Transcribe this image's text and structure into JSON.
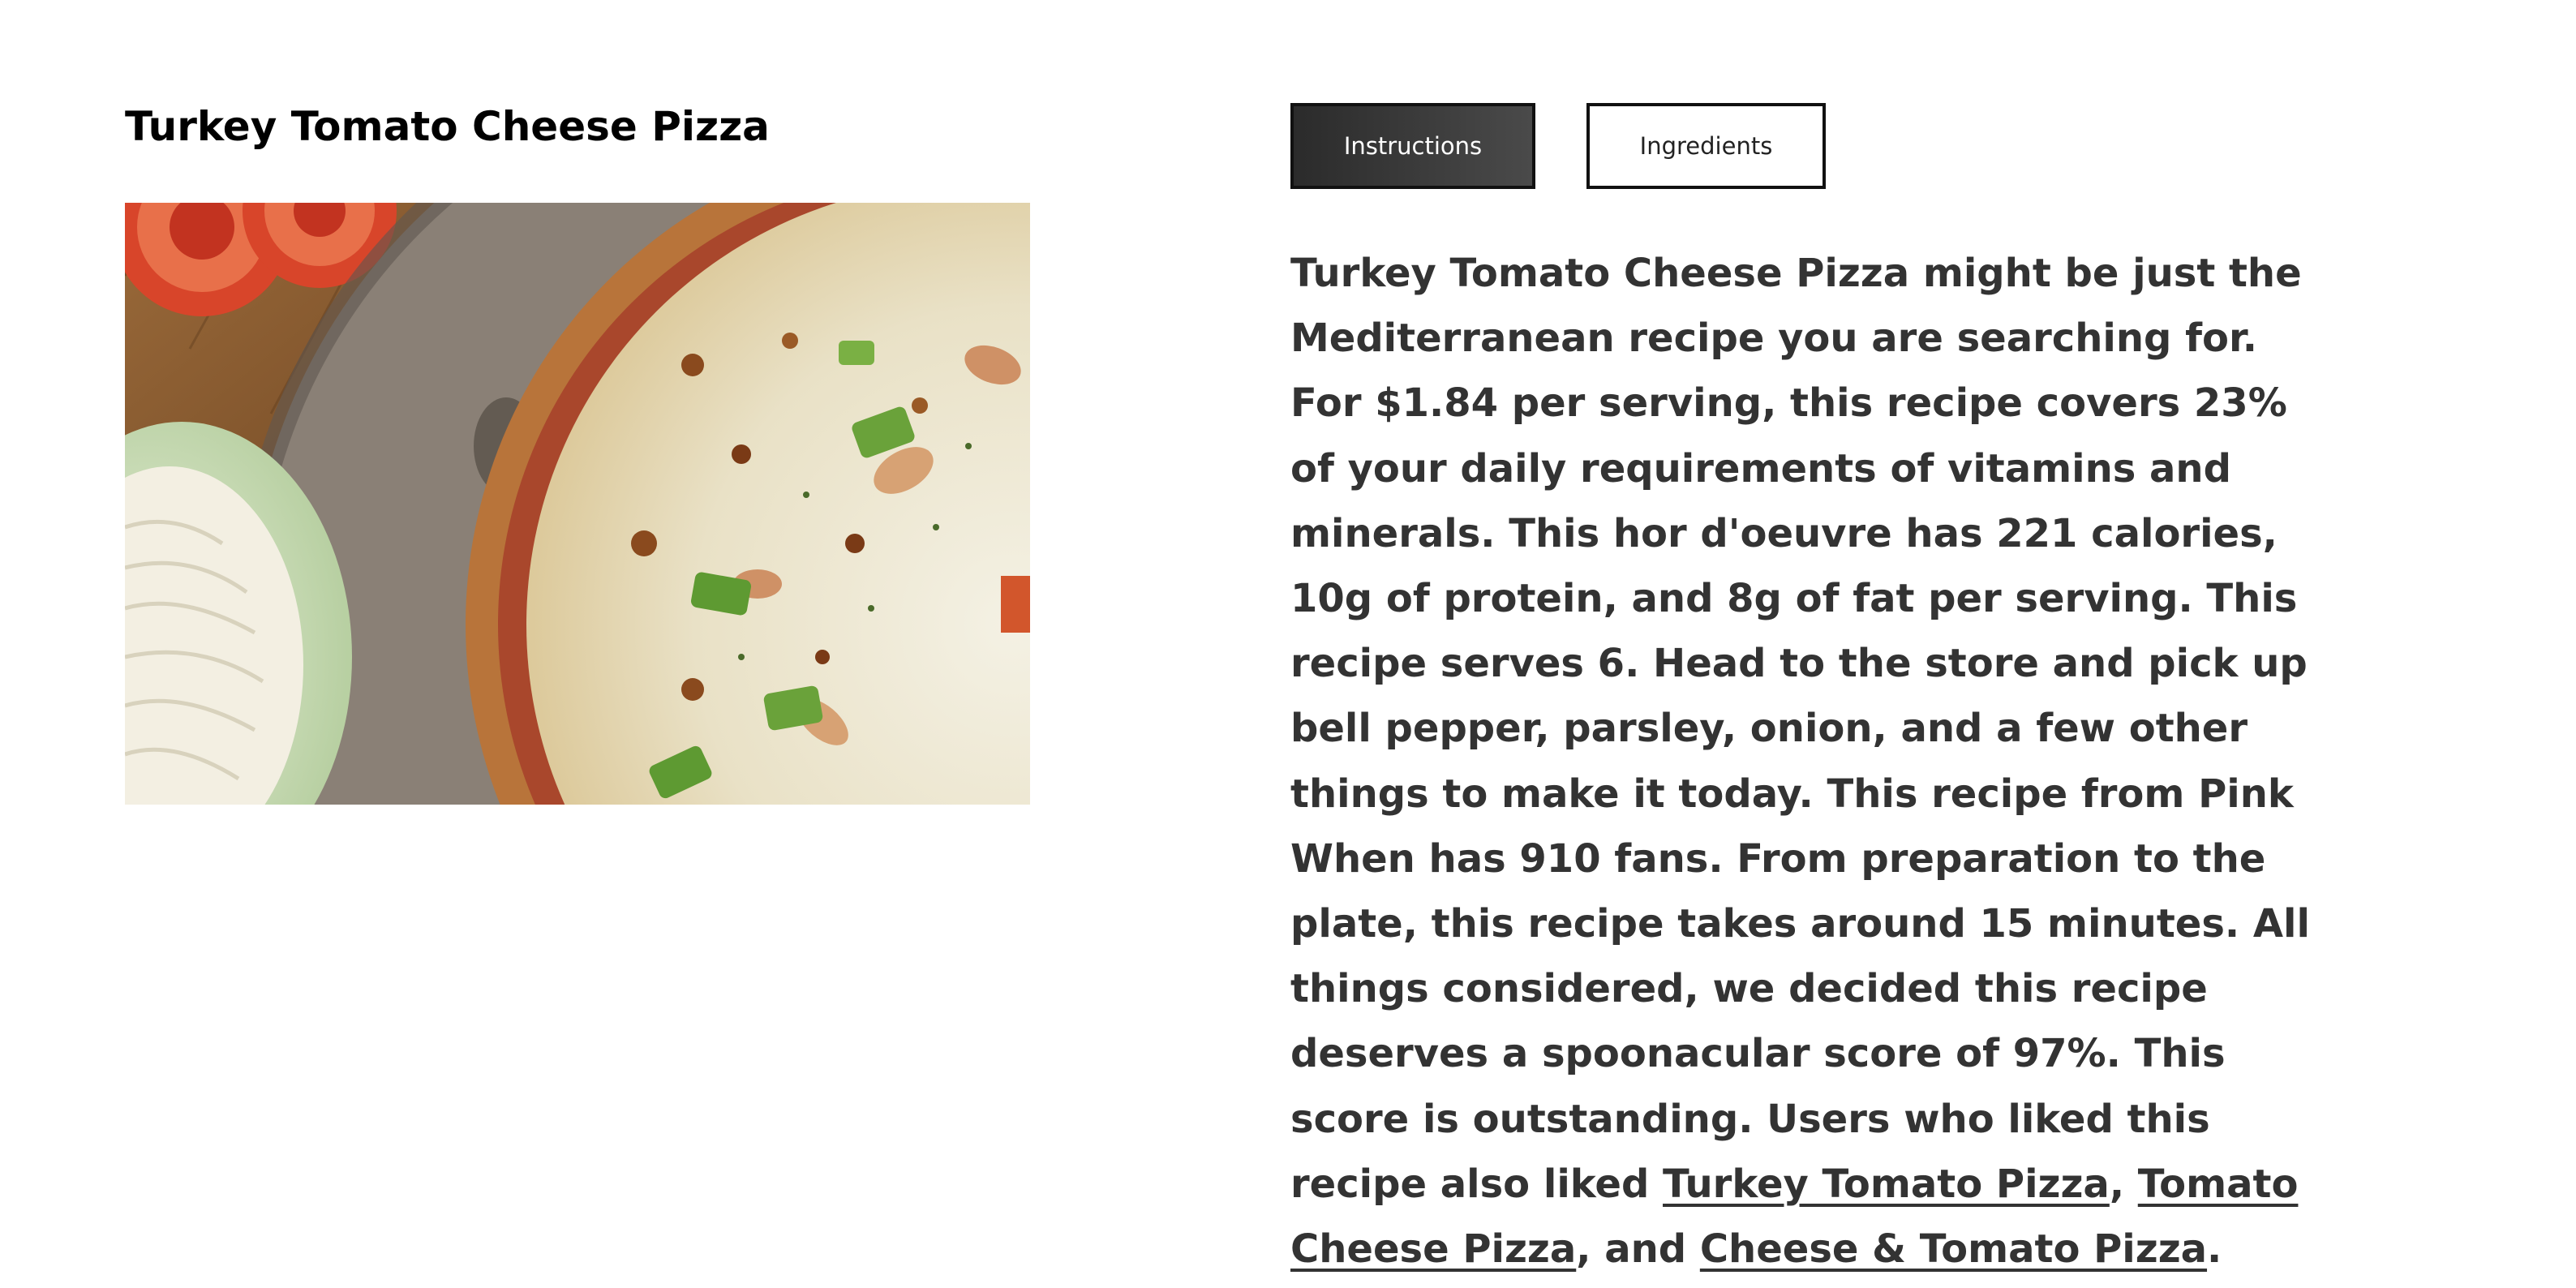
{
  "recipe": {
    "title": "Turkey Tomato Cheese Pizza",
    "image_alt": "Turkey Tomato Cheese Pizza"
  },
  "tabs": {
    "instructions_label": "Instructions",
    "ingredients_label": "Ingredients",
    "active": "Instructions"
  },
  "summary": {
    "intro": "Turkey Tomato Cheese Pizza might be just the Mediterranean recipe you are searching for. For $1.84 per serving, this recipe covers 23% of your daily requirements of vitamins and minerals. This hor d'oeuvre has 221 calories, 10g of protein, and 8g of fat per serving. This recipe serves 6. Head to the store and pick up bell pepper, parsley, onion, and a few other things to make it today. This recipe from Pink When has 910 fans. From preparation to the plate, this recipe takes around 15 minutes. All things considered, we decided this recipe deserves a spoonacular score of 97%. This score is outstanding. Users who liked this recipe also liked ",
    "link1": "Turkey Tomato Pizza",
    "sep1": ", ",
    "link2": "Tomato Cheese Pizza",
    "sep2": ", and ",
    "link3": "Cheese & Tomato Pizza",
    "end": "."
  },
  "colors": {
    "text": "#333333",
    "active_tab_bg": "#3a3a3a",
    "tab_border": "#111111",
    "background": "#ffffff"
  }
}
